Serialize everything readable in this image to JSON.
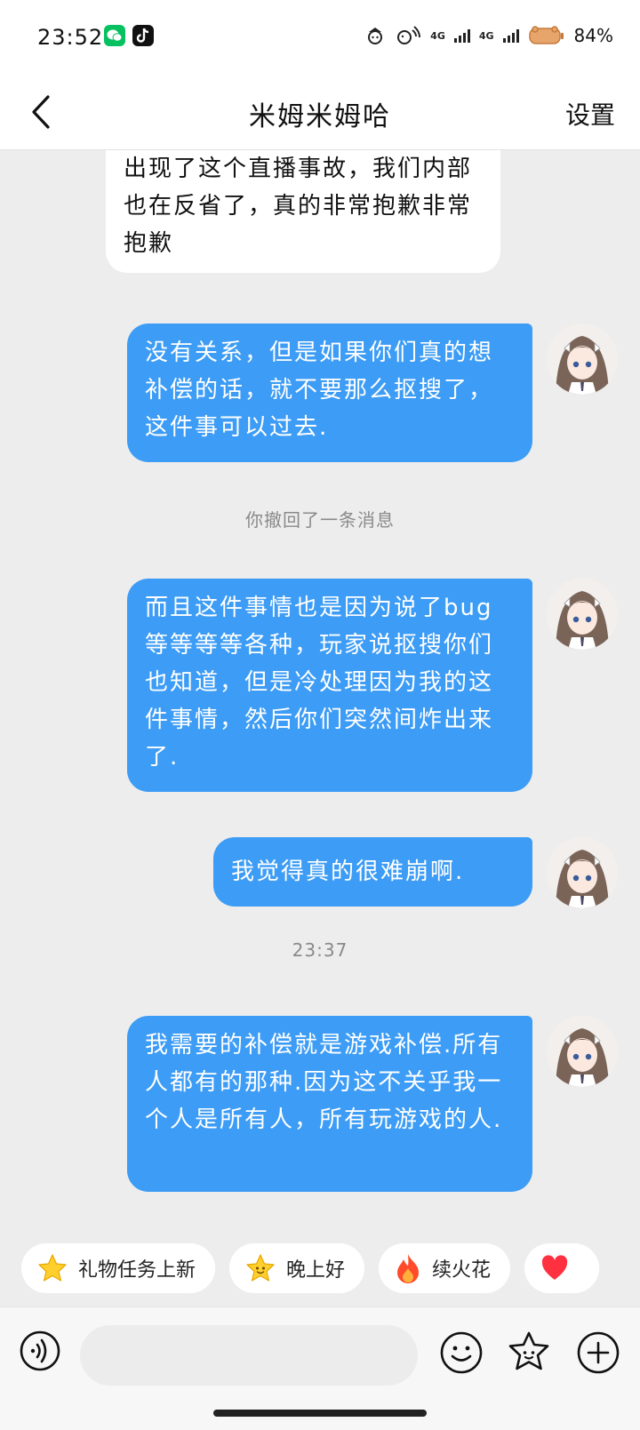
{
  "status_bar": {
    "time": "23:52",
    "network_1": "4G",
    "network_2": "4G",
    "battery": "84%",
    "apps": [
      "wechat-icon",
      "tiktok-icon"
    ]
  },
  "header": {
    "title": "米姆米姆哈",
    "settings_label": "设置",
    "back_icon": "chevron-left-icon"
  },
  "messages": [
    {
      "side": "in",
      "text": "出现了这个直播事故，我们内部也在反省了，真的非常抱歉非常抱歉"
    },
    {
      "side": "out",
      "text": "没有关系，但是如果你们真的想补偿的话，就不要那么抠搜了，这件事可以过去."
    },
    {
      "side": "out",
      "text": "而且这件事情也是因为说了bug等等等等各种，玩家说抠搜你们也知道，但是冷处理因为我的这件事情，然后你们突然间炸出来了."
    },
    {
      "side": "out",
      "text": "我觉得真的很难崩啊."
    },
    {
      "side": "out",
      "text": "我需要的补偿就是游戏补偿.所有人都有的那种.因为这不关乎我一个人是所有人，所有玩游戏的人."
    }
  ],
  "system_notes": {
    "recalled": "你撤回了一条消息",
    "timestamp": "23:37"
  },
  "quick_chips": [
    {
      "icon": "star-icon",
      "label": "礼物任务上新"
    },
    {
      "icon": "smiling-star-icon",
      "label": "晚上好"
    },
    {
      "icon": "fire-icon",
      "label": "续火花"
    },
    {
      "icon": "heart-icon",
      "label": ""
    }
  ],
  "input": {
    "value": "",
    "placeholder": ""
  },
  "colors": {
    "outgoing_bubble": "#3d9cf5",
    "incoming_bubble": "#ffffff",
    "chat_background": "#ededed"
  }
}
